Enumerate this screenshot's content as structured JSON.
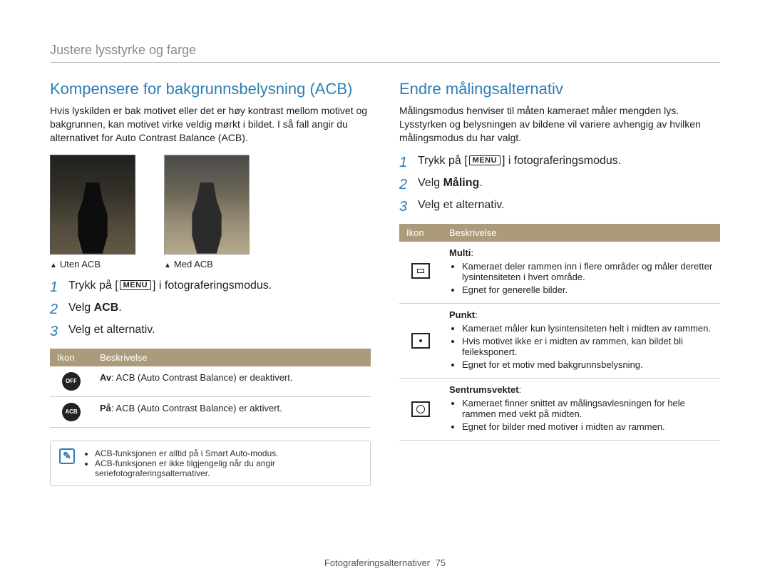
{
  "breadcrumb": "Justere lysstyrke og farge",
  "left": {
    "heading": "Kompensere for bakgrunnsbelysning (ACB)",
    "para": "Hvis lyskilden er bak motivet eller det er høy kontrast mellom motivet og bakgrunnen, kan motivet virke veldig mørkt i bildet. I så fall angir du alternativet for Auto Contrast Balance (ACB).",
    "caption1": "Uten ACB",
    "caption2": "Med ACB",
    "steps": {
      "s1_pre": "Trykk på [",
      "s1_menu": "MENU",
      "s1_post": "] i fotograferingsmodus.",
      "s2_pre": "Velg ",
      "s2_bold": "ACB",
      "s2_post": ".",
      "s3": "Velg et alternativ."
    },
    "table": {
      "h1": "Ikon",
      "h2": "Beskrivelse",
      "r1_bold": "Av",
      "r1_rest": ": ACB (Auto Contrast Balance) er deaktivert.",
      "r1_iconlabel": "OFF",
      "r2_bold": "På",
      "r2_rest": ": ACB (Auto Contrast Balance) er aktivert.",
      "r2_iconlabel": "ACB"
    },
    "notes": {
      "n1": "ACB-funksjonen er alltid på i Smart Auto-modus.",
      "n2": "ACB-funksjonen er ikke tilgjengelig når du angir seriefotograferingsalternativer."
    }
  },
  "right": {
    "heading": "Endre målingsalternativ",
    "para": "Målingsmodus henviser til måten kameraet måler mengden lys. Lysstyrken og belysningen av bildene vil variere avhengig av hvilken målingsmodus du har valgt.",
    "steps": {
      "s1_pre": "Trykk på [",
      "s1_menu": "MENU",
      "s1_post": "] i fotograferingsmodus.",
      "s2_pre": "Velg ",
      "s2_bold": "Måling",
      "s2_post": ".",
      "s3": "Velg et alternativ."
    },
    "table": {
      "h1": "Ikon",
      "h2": "Beskrivelse",
      "multi": {
        "title": "Multi",
        "b1": "Kameraet deler rammen inn i flere områder og måler deretter lysintensiteten i hvert område.",
        "b2": "Egnet for generelle bilder."
      },
      "punkt": {
        "title": "Punkt",
        "b1": "Kameraet måler kun lysintensiteten helt i midten av rammen.",
        "b2": "Hvis motivet ikke er i midten av rammen, kan bildet bli feileksponert.",
        "b3": "Egnet for et motiv med bakgrunnsbelysning."
      },
      "sentr": {
        "title": "Sentrumsvektet",
        "b1": "Kameraet finner snittet av målingsavlesningen for hele rammen med vekt på midten.",
        "b2": "Egnet for bilder med motiver i midten av rammen."
      }
    }
  },
  "footer": {
    "section": "Fotograferingsalternativer",
    "page": "75"
  }
}
